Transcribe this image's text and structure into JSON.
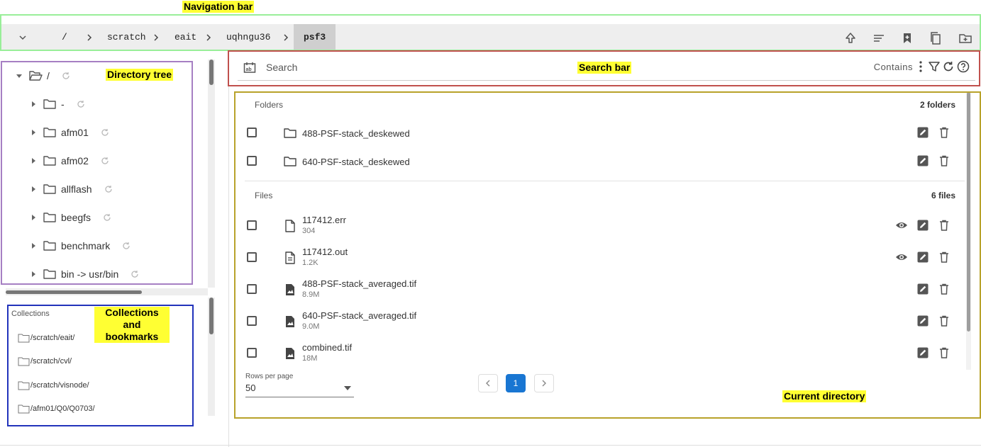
{
  "annotations": {
    "navigation_bar": "Navigation bar",
    "directory_tree": "Directory tree",
    "search_bar": "Search bar",
    "collections_line1": "Collections and",
    "collections_line2": "bookmarks",
    "current_directory": "Current directory"
  },
  "breadcrumb": {
    "root": "/",
    "items": [
      "scratch",
      "eait",
      "uqhngu36",
      "psf3"
    ]
  },
  "tree": {
    "root": "/",
    "items": [
      "-",
      "afm01",
      "afm02",
      "allflash",
      "beegfs",
      "benchmark",
      "bin -> usr/bin"
    ]
  },
  "collections": {
    "title": "Collections",
    "items": [
      "/scratch/eait/",
      "/scratch/cvl/",
      "/scratch/visnode/",
      "/afm01/Q0/Q0703/"
    ]
  },
  "search": {
    "placeholder": "Search",
    "mode": "Contains"
  },
  "folders": {
    "label": "Folders",
    "count": "2 folders",
    "items": [
      "488-PSF-stack_deskewed",
      "640-PSF-stack_deskewed"
    ]
  },
  "files": {
    "label": "Files",
    "count": "6 files",
    "items": [
      {
        "name": "117412.err",
        "size": "304",
        "icon": "file-icon"
      },
      {
        "name": "117412.out",
        "size": "1.2K",
        "icon": "text-file-icon"
      },
      {
        "name": "488-PSF-stack_averaged.tif",
        "size": "8.9M",
        "icon": "image-file-icon"
      },
      {
        "name": "640-PSF-stack_averaged.tif",
        "size": "9.0M",
        "icon": "image-file-icon"
      },
      {
        "name": "combined.tif",
        "size": "18M",
        "icon": "image-file-icon"
      }
    ]
  },
  "pagination": {
    "rows_label": "Rows per page",
    "rows_value": "50",
    "current_page": "1"
  },
  "colors": {
    "accent": "#1976d2",
    "annotation_highlight": "#ffff33"
  }
}
